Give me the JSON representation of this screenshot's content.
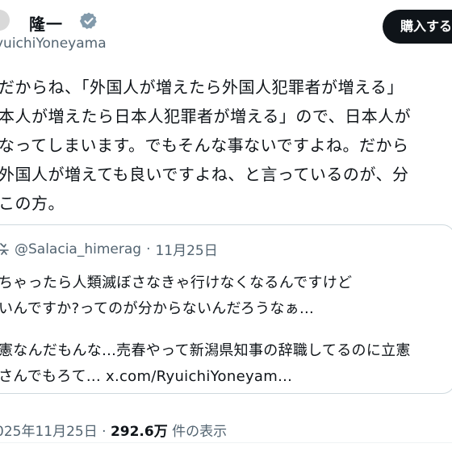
{
  "author": {
    "name": "隆一",
    "handle": "yuichiYoneyama"
  },
  "subscribe_button": "購入する",
  "post": {
    "lines": [
      "だからね、「外国人が増えたら外国人犯罪者が増える」",
      "本人が増えたら日本人犯罪者が増える」ので、日本人が",
      "なってしまいます。でもそんな事ないですよね。だから",
      "外国人が増えても良いですよね、と言っているのが、分",
      "この方。"
    ]
  },
  "quote": {
    "author_handle": "@Salacia_himerag",
    "separator": "·",
    "date": "11月25日",
    "lines": [
      "ちゃったら人類滅ぼさなきゃ行けなくなるんですけど",
      "いんですか?ってのが分からないんだろうなぁ...",
      "",
      "憲なんだもんな...売春やって新潟県知事の辞職してるのに立憲",
      "さんでもろて... x.com/RyuichiYoneyam..."
    ]
  },
  "meta": {
    "date": "025年11月25日",
    "separator": "·",
    "views": "292.6万",
    "views_label": "件の表示"
  },
  "colors": {
    "text": "#0f1419",
    "secondary": "#536471",
    "verified": "#829aab",
    "border": "#cfd9de"
  }
}
